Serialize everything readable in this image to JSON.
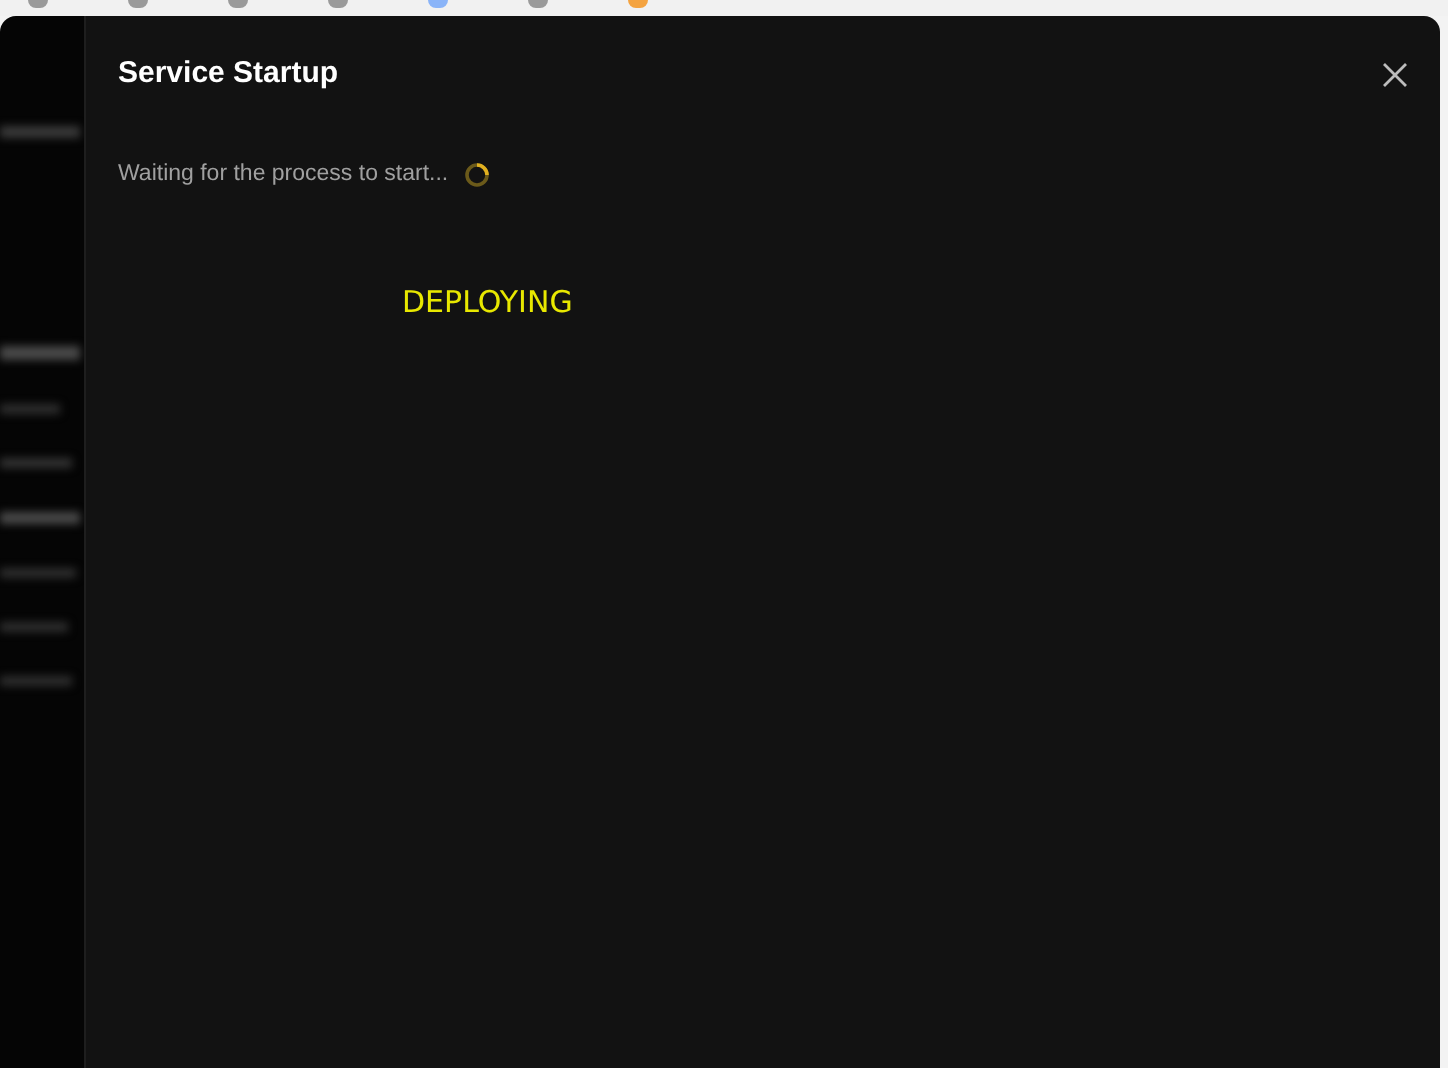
{
  "dialog": {
    "title": "Service Startup",
    "status_message": "Waiting for the process to start...",
    "loading": true,
    "overlay_label": "DEPLOYING"
  }
}
